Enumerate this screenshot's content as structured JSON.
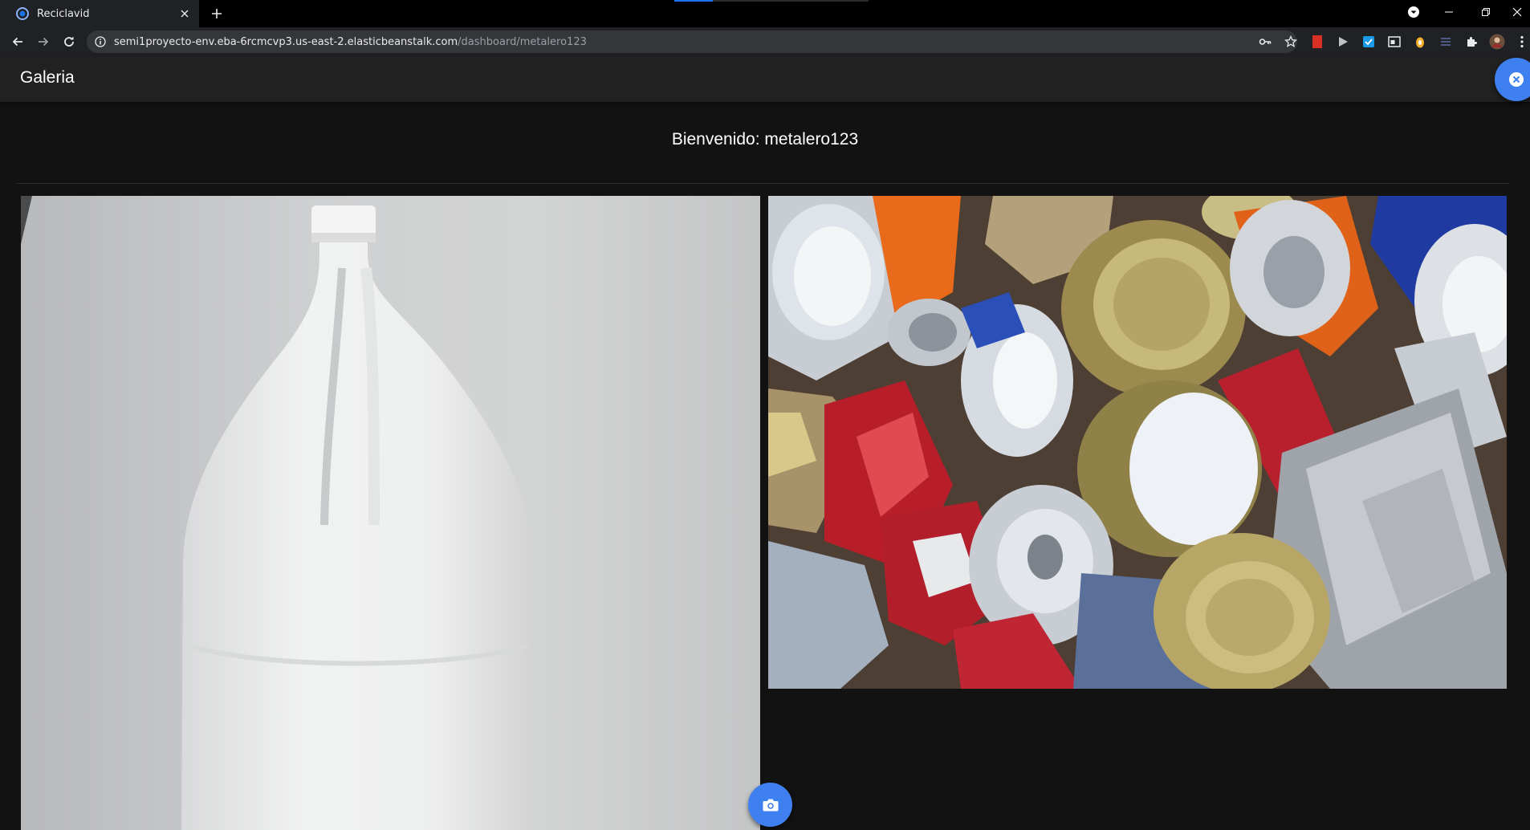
{
  "browser": {
    "tab": {
      "title": "Reciclavid"
    },
    "address": {
      "host": "semi1proyecto-env.eba-6rcmcvp3.us-east-2.elasticbeanstalk.com",
      "path": "/dashboard/metalero123"
    },
    "icons": {
      "back": "arrow-left-icon",
      "forward": "arrow-right-icon",
      "reload": "reload-icon",
      "site_info": "info-icon",
      "password_key": "key-icon",
      "bookmark": "star-icon",
      "extensions": "puzzle-icon",
      "menu": "kebab-menu-icon"
    }
  },
  "app": {
    "title": "Galeria",
    "welcome": "Bienvenido: metalero123",
    "accent_color": "#3f80f0",
    "gallery": [
      {
        "name": "white plastic jug"
      },
      {
        "name": "crushed metal cans"
      }
    ],
    "icons": {
      "close_fab": "close-circle-icon",
      "camera_fab": "camera-icon"
    }
  }
}
